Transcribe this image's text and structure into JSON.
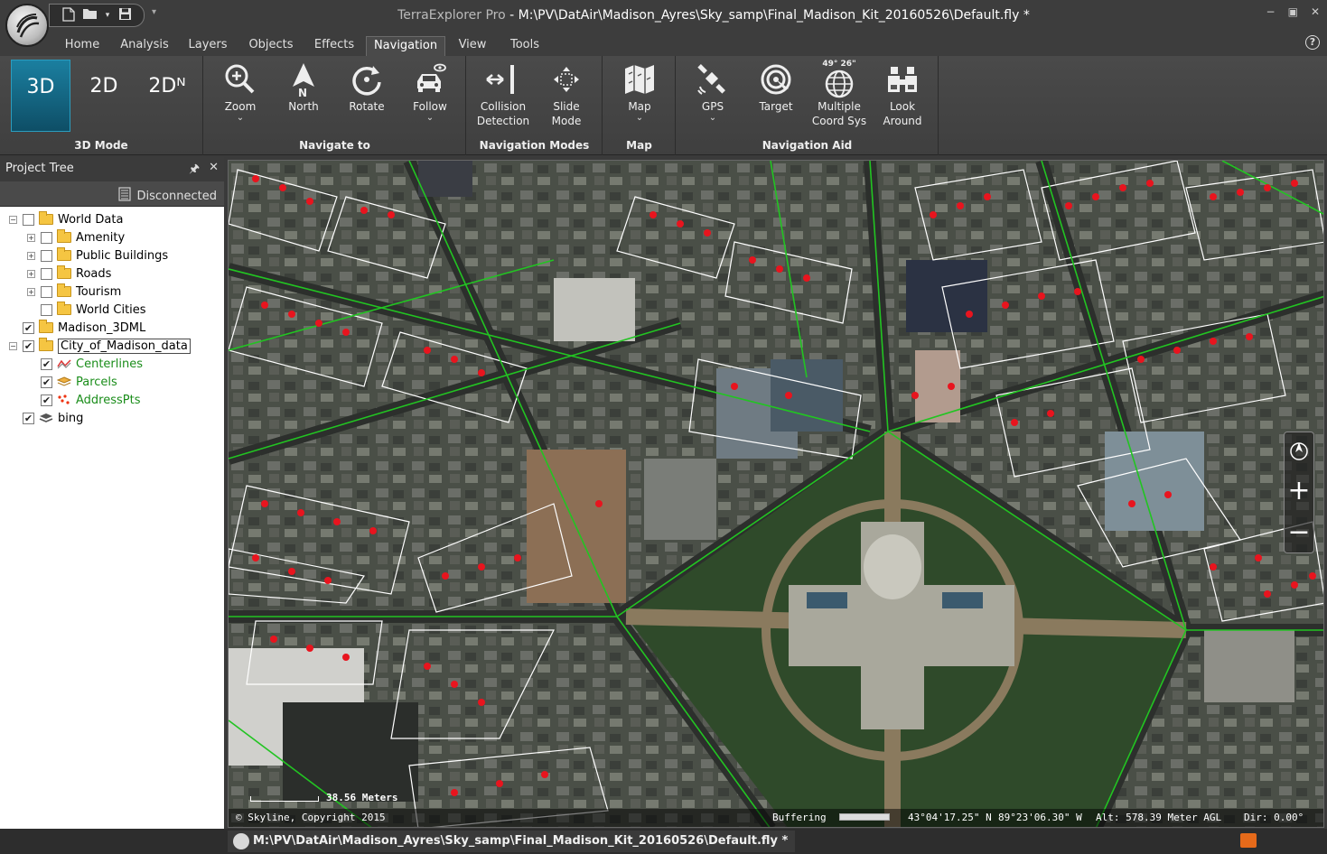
{
  "window": {
    "app_name": "TerraExplorer Pro",
    "title_sep": " - ",
    "file_path": "M:\\PV\\DatAir\\Madison_Ayres\\Sky_samp\\Final_Madison_Kit_20160526\\Default.fly *",
    "controls": [
      "−",
      "▣",
      "✕"
    ]
  },
  "qat": {
    "icons": [
      "new-file-icon",
      "open-folder-icon",
      "save-icon"
    ],
    "more": "▾"
  },
  "ribbon_tabs": [
    "Home",
    "Analysis",
    "Layers",
    "Objects",
    "Effects",
    "Navigation",
    "View",
    "Tools"
  ],
  "active_tab": "Navigation",
  "ribbon": {
    "mode_group": {
      "label": "3D Mode",
      "buttons": [
        "3D",
        "2D",
        "2Dᴺ"
      ]
    },
    "navigate_group": {
      "label": "Navigate to",
      "buttons": [
        {
          "label": "Zoom",
          "icon": "zoom-icon",
          "dropdown": true
        },
        {
          "label": "North",
          "icon": "north-arrow-icon",
          "dropdown": false
        },
        {
          "label": "Rotate",
          "icon": "rotate-icon",
          "dropdown": false
        },
        {
          "label": "Follow",
          "icon": "follow-car-icon",
          "dropdown": true
        }
      ]
    },
    "nav_modes_group": {
      "label": "Navigation Modes",
      "buttons": [
        {
          "label": "Collision",
          "label2": "Detection",
          "icon": "collision-icon"
        },
        {
          "label": "Slide",
          "label2": "Mode",
          "icon": "slide-mode-icon"
        }
      ]
    },
    "map_group": {
      "label": "Map",
      "buttons": [
        {
          "label": "Map",
          "icon": "map-icon",
          "dropdown": true
        }
      ]
    },
    "nav_aid_group": {
      "label": "Navigation Aid",
      "buttons": [
        {
          "label": "GPS",
          "label2": "",
          "icon": "satellite-icon",
          "dropdown": true
        },
        {
          "label": "Target",
          "label2": "",
          "icon": "target-icon"
        },
        {
          "label": "Multiple",
          "label2": "Coord Sys",
          "icon": "globe-coords-icon",
          "overlay": "49° 26\""
        },
        {
          "label": "Look",
          "label2": "Around",
          "icon": "binoculars-icon"
        }
      ]
    }
  },
  "project_tree": {
    "title": "Project Tree",
    "status": "Disconnected",
    "nodes": [
      {
        "label": "World Data",
        "level": 0,
        "expander": "−",
        "checked": false,
        "icon": "folder"
      },
      {
        "label": "Amenity",
        "level": 1,
        "expander": "+",
        "checked": false,
        "icon": "folder"
      },
      {
        "label": "Public Buildings",
        "level": 1,
        "expander": "+",
        "checked": false,
        "icon": "folder"
      },
      {
        "label": "Roads",
        "level": 1,
        "expander": "+",
        "checked": false,
        "icon": "folder"
      },
      {
        "label": "Tourism",
        "level": 1,
        "expander": "+",
        "checked": false,
        "icon": "folder"
      },
      {
        "label": "World Cities",
        "level": 1,
        "expander": "",
        "checked": false,
        "icon": "folder"
      },
      {
        "label": "Madison_3DML",
        "level": 0,
        "expander": "",
        "checked": true,
        "icon": "folder"
      },
      {
        "label": "City_of_Madison_data",
        "level": 0,
        "expander": "−",
        "checked": true,
        "icon": "folder",
        "selected": true
      },
      {
        "label": "Centerlines",
        "level": 1,
        "expander": "",
        "checked": true,
        "icon": "lines",
        "green": true
      },
      {
        "label": "Parcels",
        "level": 1,
        "expander": "",
        "checked": true,
        "icon": "polygons",
        "green": true
      },
      {
        "label": "AddressPts",
        "level": 1,
        "expander": "",
        "checked": true,
        "icon": "points",
        "green": true
      },
      {
        "label": "bing",
        "level": 0,
        "expander": "",
        "checked": true,
        "icon": "layers"
      }
    ]
  },
  "map": {
    "scale": "38.56 Meters",
    "copyright": "© Skyline, Copyright 2015",
    "buffering": "Buffering",
    "lat": "43°04'17.25\" N",
    "lon": "89°23'06.30\" W",
    "alt": "Alt: 578.39 Meter AGL",
    "dir": "Dir: 0.00°",
    "nav_buttons": [
      "compass-icon",
      "zoom-in-icon",
      "zoom-out-icon"
    ],
    "colors": {
      "centerlines": "#22c422",
      "parcels": "#ffffff",
      "address_pts": "#e8141e"
    }
  },
  "doc_tab": {
    "label": "M:\\PV\\DatAir\\Madison_Ayres\\Sky_samp\\Final_Madison_Kit_20160526\\Default.fly *"
  }
}
